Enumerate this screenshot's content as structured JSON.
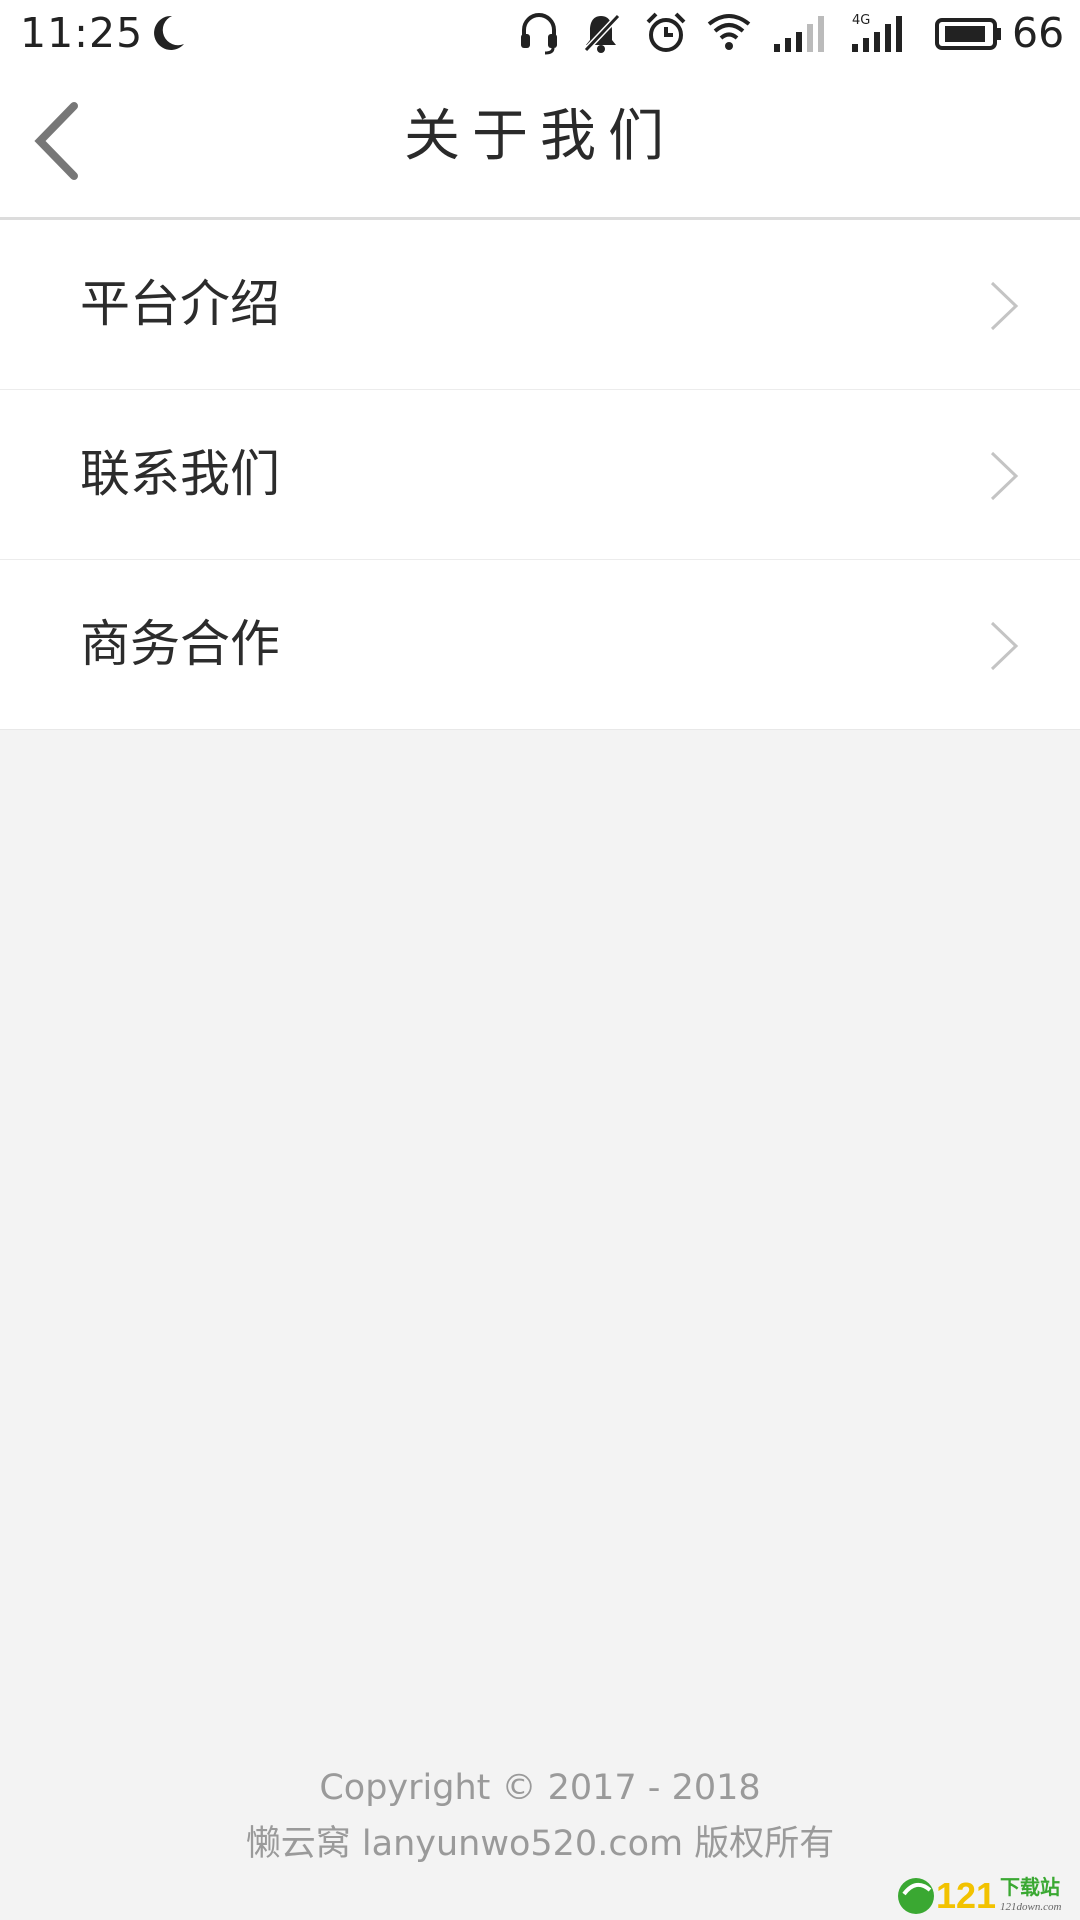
{
  "status_bar": {
    "time": "11:25",
    "battery_level": "66",
    "network_label": "4G",
    "icons": [
      "moon-icon",
      "headphones-icon",
      "bell-muted-icon",
      "alarm-icon",
      "wifi-icon",
      "signal-icon",
      "signal-4g-icon",
      "battery-icon"
    ]
  },
  "nav": {
    "title": "关于我们",
    "back_icon": "chevron-left-icon"
  },
  "menu": {
    "items": [
      {
        "label": "平台介绍"
      },
      {
        "label": "联系我们"
      },
      {
        "label": "商务合作"
      }
    ]
  },
  "footer": {
    "copyright": "Copyright © 2017 - 2018",
    "owner": "懒云窝 lanyunwo520.com 版权所有"
  },
  "watermark": {
    "text": "121下载站",
    "sub_text": "121down.com"
  },
  "colors": {
    "background": "#f3f3f3",
    "surface": "#ffffff",
    "title_text": "#2a2a2a",
    "footer_text": "#9a9a9a",
    "chevron": "#c4c4c4",
    "watermark_green": "#3aa832"
  }
}
